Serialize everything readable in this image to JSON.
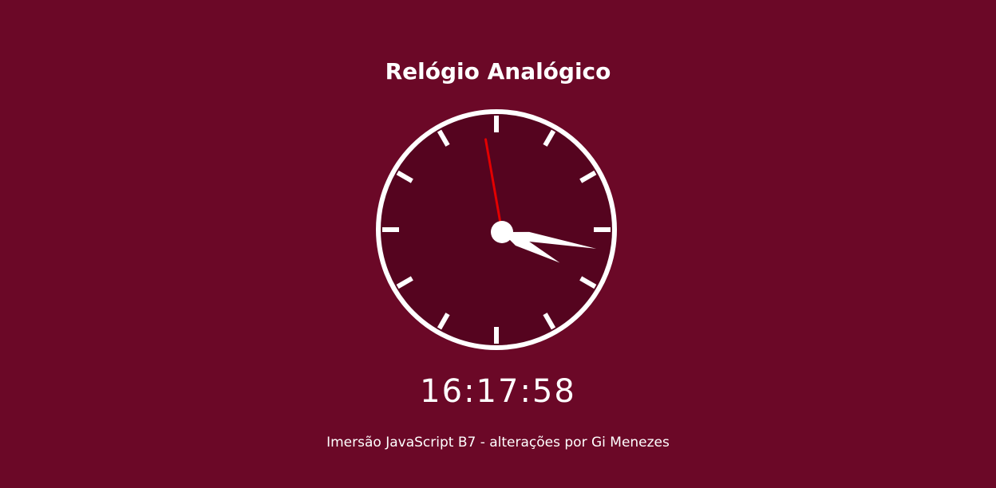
{
  "title": "Relógio Analógico",
  "clock": {
    "hours": 16,
    "minutes": 17,
    "seconds": 58,
    "face_color": "#55041f",
    "background_color": "#6b0827",
    "rim_color": "#ffffff",
    "hand_color": "#ffffff",
    "second_hand_color": "#e30000"
  },
  "digital_time": "16:17:58",
  "footer": "Imersão JavaScript B7 - alterações por Gi Menezes"
}
